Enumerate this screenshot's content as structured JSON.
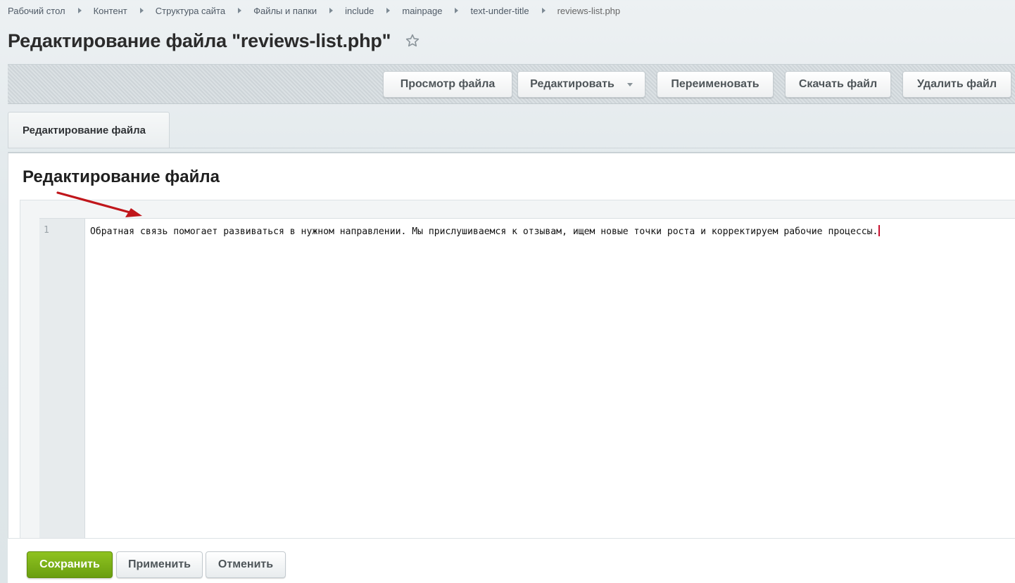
{
  "breadcrumb": {
    "items": [
      "Рабочий стол",
      "Контент",
      "Структура сайта",
      "Файлы и папки",
      "include",
      "mainpage",
      "text-under-title"
    ],
    "current": "reviews-list.php"
  },
  "page": {
    "title": "Редактирование файла \"reviews-list.php\"",
    "favorite_icon": "star-icon"
  },
  "toolbar": {
    "view_label": "Просмотр файла",
    "edit_label": "Редактировать",
    "rename_label": "Переименовать",
    "download_label": "Скачать файл",
    "delete_label": "Удалить файл"
  },
  "tabs": [
    {
      "label": "Редактирование файла",
      "active": true
    }
  ],
  "editor": {
    "section_title": "Редактирование файла",
    "lines": [
      {
        "number": "1",
        "text": "Обратная связь помогает развиваться в нужном направлении. Мы прислушиваемся к отзывам, ищем новые точки роста и корректируем рабочие процессы."
      }
    ]
  },
  "footer": {
    "save_label": "Сохранить",
    "apply_label": "Применить",
    "cancel_label": "Отменить"
  },
  "colors": {
    "save_button": "#7cb518",
    "annotation_arrow": "#c0161b",
    "cursor": "#c8102e"
  }
}
